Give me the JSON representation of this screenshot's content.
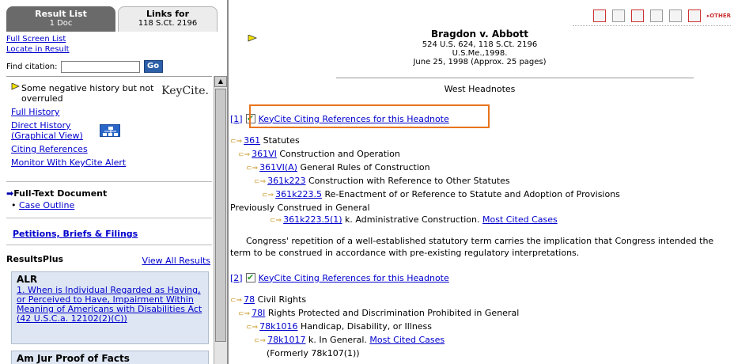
{
  "left": {
    "tabs": {
      "result_list": {
        "title": "Result List",
        "sub": "1 Doc"
      },
      "links_for": {
        "title": "Links for",
        "sub": "118 S.Ct. 2196"
      }
    },
    "links": [
      "Full Screen List",
      "Locate in Result"
    ],
    "find_label": "Find citation:",
    "find_value": "",
    "go_label": "Go",
    "keycite": {
      "status": "Some negative history but not overruled",
      "logo": "KeyCite.",
      "links": [
        "Full History",
        "Direct History (Graphical View)",
        "Citing References",
        "Monitor With KeyCite Alert"
      ]
    },
    "full_text": {
      "heading": "Full-Text Document",
      "outline": "Case Outline"
    },
    "petitions": "Petitions, Briefs & Filings",
    "results_plus": {
      "logo": "ResultsPlus",
      "view_all": "View All Results"
    },
    "alr": {
      "title": "ALR",
      "link": "1. When is Individual Regarded as Having, or Perceived to Have, Impairment Within Meaning of Americans with Disabilities Act (42 U.S.C.a. 12102(2)(C))"
    },
    "amjur": {
      "title": "Am Jur Proof of Facts"
    }
  },
  "toolbar": {
    "other_label": "OTHER",
    "icons": [
      "pdf-icon",
      "copy-icon",
      "print-icon",
      "printer-icon",
      "email-icon",
      "download-icon",
      "other-icon"
    ]
  },
  "case": {
    "title": "Bragdon v. Abbott",
    "cite": "524 U.S. 624, 118 S.Ct. 2196",
    "court": "U.S.Me.,1998.",
    "date": "June 25, 1998 (Approx. 25 pages)",
    "section": "West Headnotes"
  },
  "headnotes": [
    {
      "num": "[1]",
      "kc_label": "KeyCite Citing References for this Headnote",
      "keys": [
        {
          "code": "361",
          "text": " Statutes",
          "indent": 0
        },
        {
          "code": "361VI",
          "text": " Construction and Operation",
          "indent": 1
        },
        {
          "code": "361VI(A)",
          "text": " General Rules of Construction",
          "indent": 2
        },
        {
          "code": "361k223",
          "text": " Construction with Reference to Other Statutes",
          "indent": 3
        },
        {
          "code": "361k223.5",
          "text": " Re-Enactment of or Reference to Statute and Adoption of Provisions",
          "indent": 4
        },
        {
          "code": "",
          "text": "Previously Construed in General",
          "indent": 0
        },
        {
          "code": "361k223.5(1)",
          "text": " k. Administrative Construction. ",
          "indent": 5,
          "most_cited": "Most Cited Cases"
        }
      ],
      "para": "Congress' repetition of a well-established statutory term carries the implication that Congress intended the term to be construed in accordance with pre-existing regulatory interpretations."
    },
    {
      "num": "[2]",
      "kc_label": "KeyCite Citing References for this Headnote",
      "keys": [
        {
          "code": "78",
          "text": " Civil Rights",
          "indent": 0
        },
        {
          "code": "78I",
          "text": " Rights Protected and Discrimination Prohibited in General",
          "indent": 1
        },
        {
          "code": "78k1016",
          "text": " Handicap, Disability, or Illness",
          "indent": 2
        },
        {
          "code": "78k1017",
          "text": " k. In General. ",
          "indent": 3,
          "most_cited": "Most Cited Cases"
        },
        {
          "code": "",
          "text": "(Formerly 78k107(1))",
          "indent": 3
        }
      ]
    }
  ],
  "colors": {
    "highlight": "#e8741c",
    "link": "#0000cc",
    "tab_active": "#6a6a6a"
  }
}
